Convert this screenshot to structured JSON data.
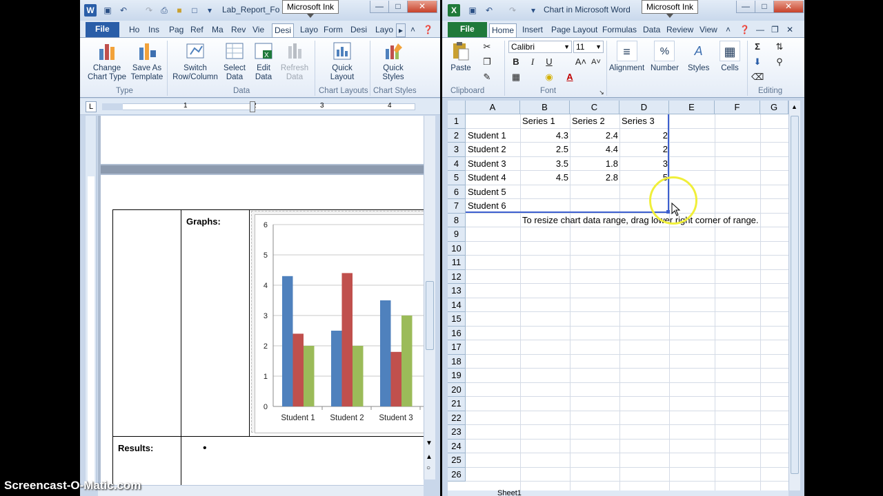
{
  "word": {
    "title": "Lab_Report_Fo",
    "ink_popup": "Microsoft Ink",
    "file_tab": "File",
    "tabs": [
      "Ho",
      "Ins",
      "Pag",
      "Ref",
      "Ma",
      "Rev",
      "Vie",
      "Desi",
      "Layo",
      "Form",
      "Desi",
      "Layo"
    ],
    "active_tab": "Desi",
    "ribbon": {
      "change_chart_type": "Change Chart Type",
      "save_as_template": "Save As Template",
      "switch_row_column": "Switch Row/Column",
      "select_data": "Select Data",
      "edit_data": "Edit Data",
      "refresh_data": "Refresh Data",
      "quick_layout": "Quick Layout",
      "quick_styles": "Quick Styles",
      "group_type": "Type",
      "group_data": "Data",
      "group_chart_layouts": "Chart Layouts",
      "group_chart_styles": "Chart Styles"
    },
    "ruler_numbers": [
      "1",
      "2",
      "3",
      "4"
    ],
    "doc": {
      "graphs_label": "Graphs:",
      "results_label": "Results:",
      "bullet": "•"
    }
  },
  "chart_data": {
    "type": "bar",
    "categories": [
      "Student 1",
      "Student 2",
      "Student 3"
    ],
    "series": [
      {
        "values": [
          4.3,
          2.5,
          3.5
        ],
        "color": "#4f81bd"
      },
      {
        "values": [
          2.4,
          4.4,
          1.8
        ],
        "color": "#c0504d"
      },
      {
        "values": [
          2,
          2,
          3
        ],
        "color": "#9bbb59"
      }
    ],
    "yticks": [
      "0",
      "1",
      "2",
      "3",
      "4",
      "5",
      "6"
    ],
    "ylim": [
      0,
      6
    ],
    "grid": true
  },
  "excel": {
    "title": "Chart in Microsoft Word",
    "ink_popup": "Microsoft Ink",
    "file_tab": "File",
    "tabs": [
      "Home",
      "Insert",
      "Page Layout",
      "Formulas",
      "Data",
      "Review",
      "View"
    ],
    "active_tab": "Home",
    "ribbon": {
      "paste": "Paste",
      "font_name": "Calibri",
      "font_size": "11",
      "bold": "B",
      "italic": "I",
      "underline": "U",
      "alignment": "Alignment",
      "number": "Number",
      "styles": "Styles",
      "cells": "Cells",
      "group_clipboard": "Clipboard",
      "group_font": "Font",
      "group_editing": "Editing"
    },
    "columns": [
      "A",
      "B",
      "C",
      "D",
      "E",
      "F",
      "G"
    ],
    "rows": [
      "1",
      "2",
      "3",
      "4",
      "5",
      "6",
      "7",
      "8",
      "9",
      "10",
      "11",
      "12",
      "13",
      "14",
      "15",
      "16",
      "17",
      "18",
      "19",
      "20",
      "21",
      "22",
      "23",
      "24",
      "25",
      "26"
    ],
    "cells": {
      "b1": "Series 1",
      "c1": "Series 2",
      "d1": "Series 3",
      "a2": "Student 1",
      "b2": "4.3",
      "c2": "2.4",
      "d2": "2",
      "a3": "Student 2",
      "b3": "2.5",
      "c3": "4.4",
      "d3": "2",
      "a4": "Student 3",
      "b4": "3.5",
      "c4": "1.8",
      "d4": "3",
      "a5": "Student 4",
      "b5": "4.5",
      "c5": "2.8",
      "d5": "5",
      "a6": "Student 5",
      "a7": "Student 6",
      "b8": "To resize chart data range, drag lower right corner of range."
    },
    "sheet_tab": "Sheet1"
  },
  "watermark": "Screencast-O-Matic.com"
}
